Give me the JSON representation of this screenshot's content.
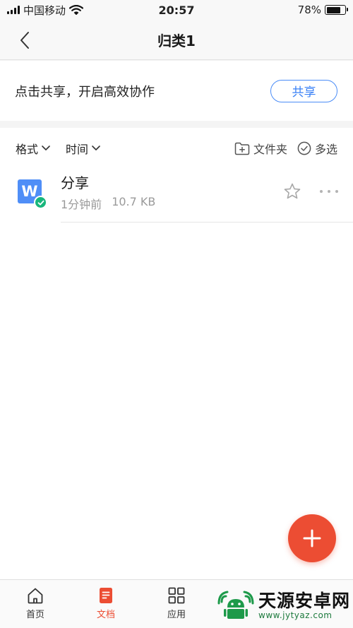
{
  "status_bar": {
    "carrier": "中国移动",
    "time": "20:57",
    "battery_percent": "78%",
    "battery_level": 0.78
  },
  "nav": {
    "title": "归类1",
    "back_icon": "chevron-left-icon"
  },
  "share_banner": {
    "text": "点击共享，开启高效协作",
    "button_label": "共享",
    "accent_color": "#3b82f6"
  },
  "filter_bar": {
    "format_label": "格式",
    "time_label": "时间",
    "folder_label": "文件夹",
    "multiselect_label": "多选"
  },
  "files": [
    {
      "name": "分享",
      "time": "1分钟前",
      "size": "10.7 KB",
      "icon_letter": "W",
      "icon_color": "#4f8ef7",
      "status_color": "#18b67c"
    }
  ],
  "fab": {
    "icon": "plus-icon",
    "color": "#ec4d33"
  },
  "tab_bar": {
    "tabs": [
      {
        "label": "首页",
        "icon": "home-icon"
      },
      {
        "label": "文档",
        "icon": "document-icon"
      },
      {
        "label": "应用",
        "icon": "grid-icon"
      }
    ],
    "active_color": "#ec4d33"
  },
  "watermark": {
    "title": "天源安卓网",
    "url": "www.jytyaz.com"
  }
}
